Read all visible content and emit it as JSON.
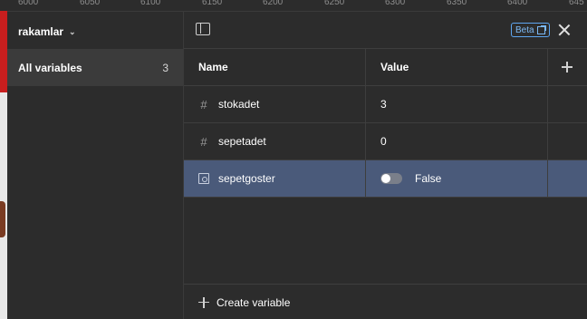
{
  "ruler": {
    "ticks": [
      "6000",
      "6050",
      "6100",
      "6150",
      "6200",
      "6250",
      "6300",
      "6350",
      "6400",
      "645"
    ]
  },
  "sidebar": {
    "collection_name": "rakamlar",
    "items": [
      {
        "label": "All variables",
        "count": "3"
      }
    ]
  },
  "header": {
    "beta_label": "Beta"
  },
  "table": {
    "columns": [
      "Name",
      "Value"
    ],
    "rows": [
      {
        "type": "number",
        "name": "stokadet",
        "value": "3"
      },
      {
        "type": "number",
        "name": "sepetadet",
        "value": "0"
      },
      {
        "type": "boolean",
        "name": "sepetgoster",
        "value": "False",
        "toggle_on": false
      }
    ]
  },
  "footer": {
    "create_label": "Create variable"
  },
  "colors": {
    "selected_row": "#4a5a7a",
    "accent": "#5ea6f0",
    "panel_bg": "#2c2c2c"
  },
  "icons": {
    "number_type": "hash-icon",
    "boolean_type": "boolean-variable-icon",
    "panel_toggle": "sidebar-panel-icon",
    "close": "close-icon",
    "add": "plus-icon",
    "external_link": "external-link-icon"
  }
}
